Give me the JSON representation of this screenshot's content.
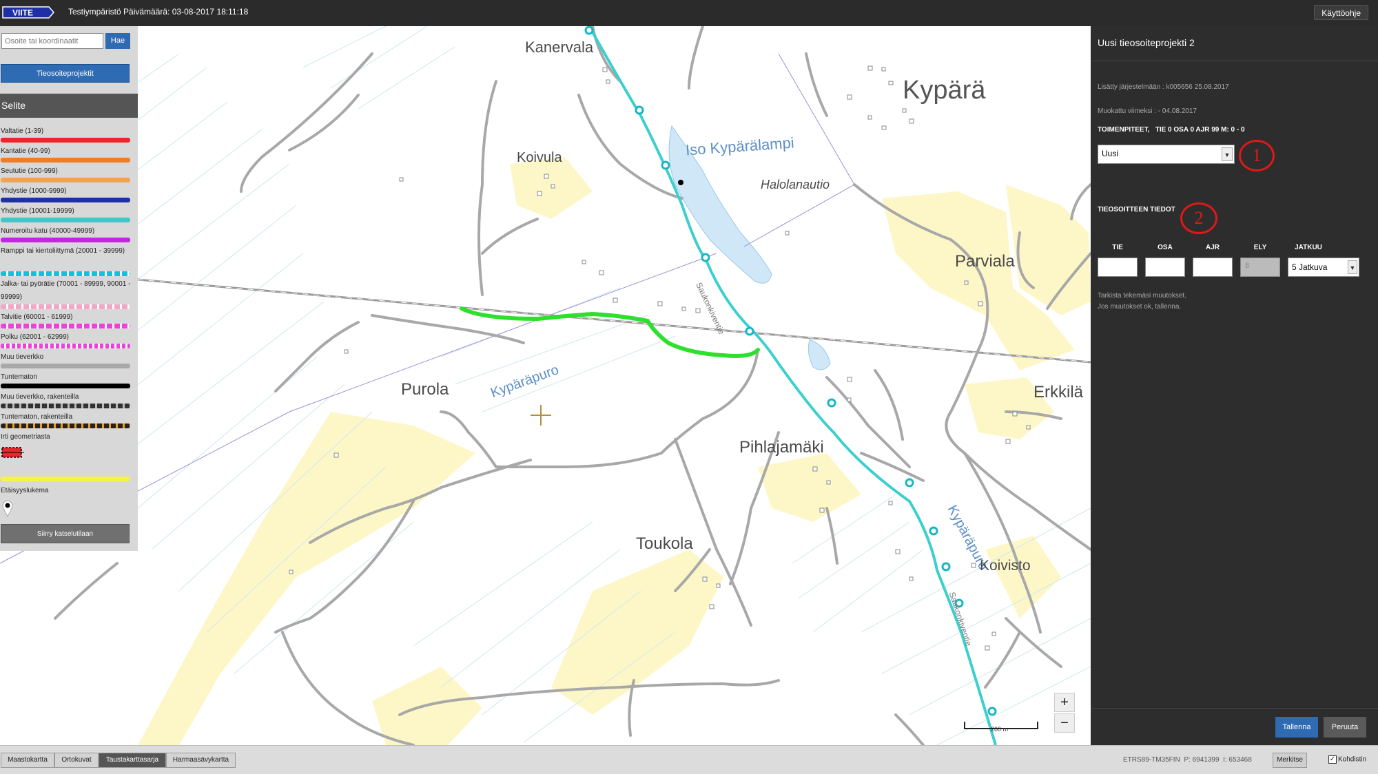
{
  "header": {
    "logo_text": "VIITE",
    "environment_text": "Testiympäristö Päivämäärä: 03-08-2017 18:11:18",
    "help_label": "Käyttöohje"
  },
  "left": {
    "search_placeholder": "Osoite tai koordinaatit",
    "search_button": "Hae",
    "projects_button": "Tieosoiteprojektit",
    "legend_title": "Selite",
    "legend_items": [
      {
        "label": "Valtatie (1-39)",
        "color": "#e8262b"
      },
      {
        "label": "Kantatie (40-99)",
        "color": "#f07d24"
      },
      {
        "label": "Seututie (100-999)",
        "color": "#f5a24f"
      },
      {
        "label": "Yhdystie (1000-9999)",
        "color": "#1f2fa8"
      },
      {
        "label": "Yhdystie (10001-19999)",
        "color": "#40c8c8"
      },
      {
        "label": "Numeroitu katu (40000-49999)",
        "color": "#c524e8"
      },
      {
        "label": "Ramppi tai kiertoliittymä (20001 - 39999)",
        "color": "#11c3d6"
      },
      {
        "label": "Jalka- tai pyörätie (70001 - 89999, 90001 - 99999)",
        "color": "#f2a7c5"
      },
      {
        "label": "Talvitie (60001 - 61999)",
        "color": "#f03fdc"
      },
      {
        "label": "Polku (62001 - 62999)",
        "color": "#f03fdc"
      },
      {
        "label": "Muu tieverkko",
        "color": "#a8a8a8"
      },
      {
        "label": "Tuntematon",
        "color": "#000000"
      },
      {
        "label": "Muu tieverkko, rakenteilla",
        "color": "#555555"
      },
      {
        "label": "Tuntematon, rakenteilla",
        "color": "#f59a1b"
      },
      {
        "label": "Irti geometriasta",
        "color": "#e8262b"
      },
      {
        "label": "Etäisyyslukema",
        "color": "#000000"
      }
    ],
    "legend_highlight_color": "#f4f442",
    "view_button": "Siirry katselutilaan"
  },
  "map": {
    "places": [
      "Kanervala",
      "Kypärä",
      "Iso Kypärälampi",
      "Koivula",
      "Halolanautio",
      "Parviala",
      "Purola",
      "Kypäräpuro",
      "Erkkilä",
      "Pihlajamäki",
      "Kypäräpuro",
      "Toukola",
      "Koivisto"
    ],
    "road_labels": [
      "Saukonkiventie",
      "Saukonkiventie"
    ],
    "scale_label": "200 m",
    "zoom_in": "+",
    "zoom_out": "−",
    "selected_road_color": "#2ee02e",
    "road_color": "#3ccfcf"
  },
  "right": {
    "title": "Uusi tieosoiteprojekti 2",
    "added_text": "Lisätty järjestelmään : k005656 25.08.2017",
    "modified_text": "Muokattu viimeksi : - 04.08.2017",
    "actions_header": "TOIMENPITEET,   TIE 0 OSA 0 AJR 99 M: 0 - 0",
    "action_value": "Uusi",
    "address_header": "TIEOSOITTEEN TIEDOT",
    "columns": [
      "TIE",
      "OSA",
      "AJR",
      "ELY",
      "JATKUU"
    ],
    "ely_value": "8",
    "jatkuu_value": "5 Jatkuva",
    "check_text_1": "Tarkista tekemäsi muutokset.",
    "check_text_2": "Jos muutokset ok, tallenna.",
    "save_button": "Tallenna",
    "cancel_button": "Peruuta",
    "annotation_1": "1",
    "annotation_2": "2"
  },
  "bottom": {
    "layers": [
      "Maastokartta",
      "Ortokuvat",
      "Taustakarttasarja",
      "Harmaasävykartta"
    ],
    "active_layer": "Taustakarttasarja",
    "coordinate_text": "ETRS89-TM35FIN  P: 6941399  I: 653468",
    "mark_button": "Merkitse",
    "target_label": "Kohdistin"
  }
}
